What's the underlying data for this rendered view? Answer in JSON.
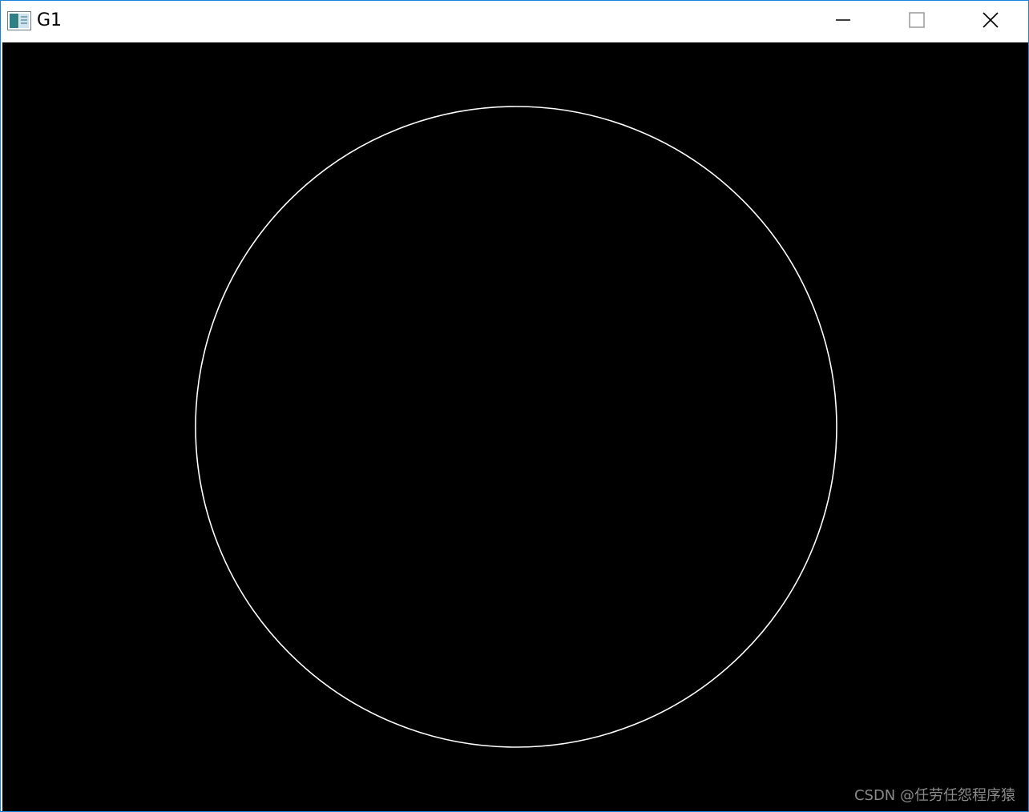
{
  "window": {
    "title": "G1",
    "controls": {
      "minimize_icon": "minimize-icon",
      "maximize_icon": "maximize-icon",
      "close_icon": "close-icon"
    },
    "border_color": "#1883d7"
  },
  "canvas": {
    "background_color": "#000000",
    "shape": {
      "type": "circle",
      "stroke_color": "#ffffff"
    }
  },
  "watermark": {
    "text": "CSDN @任劳任怨程序猿"
  }
}
